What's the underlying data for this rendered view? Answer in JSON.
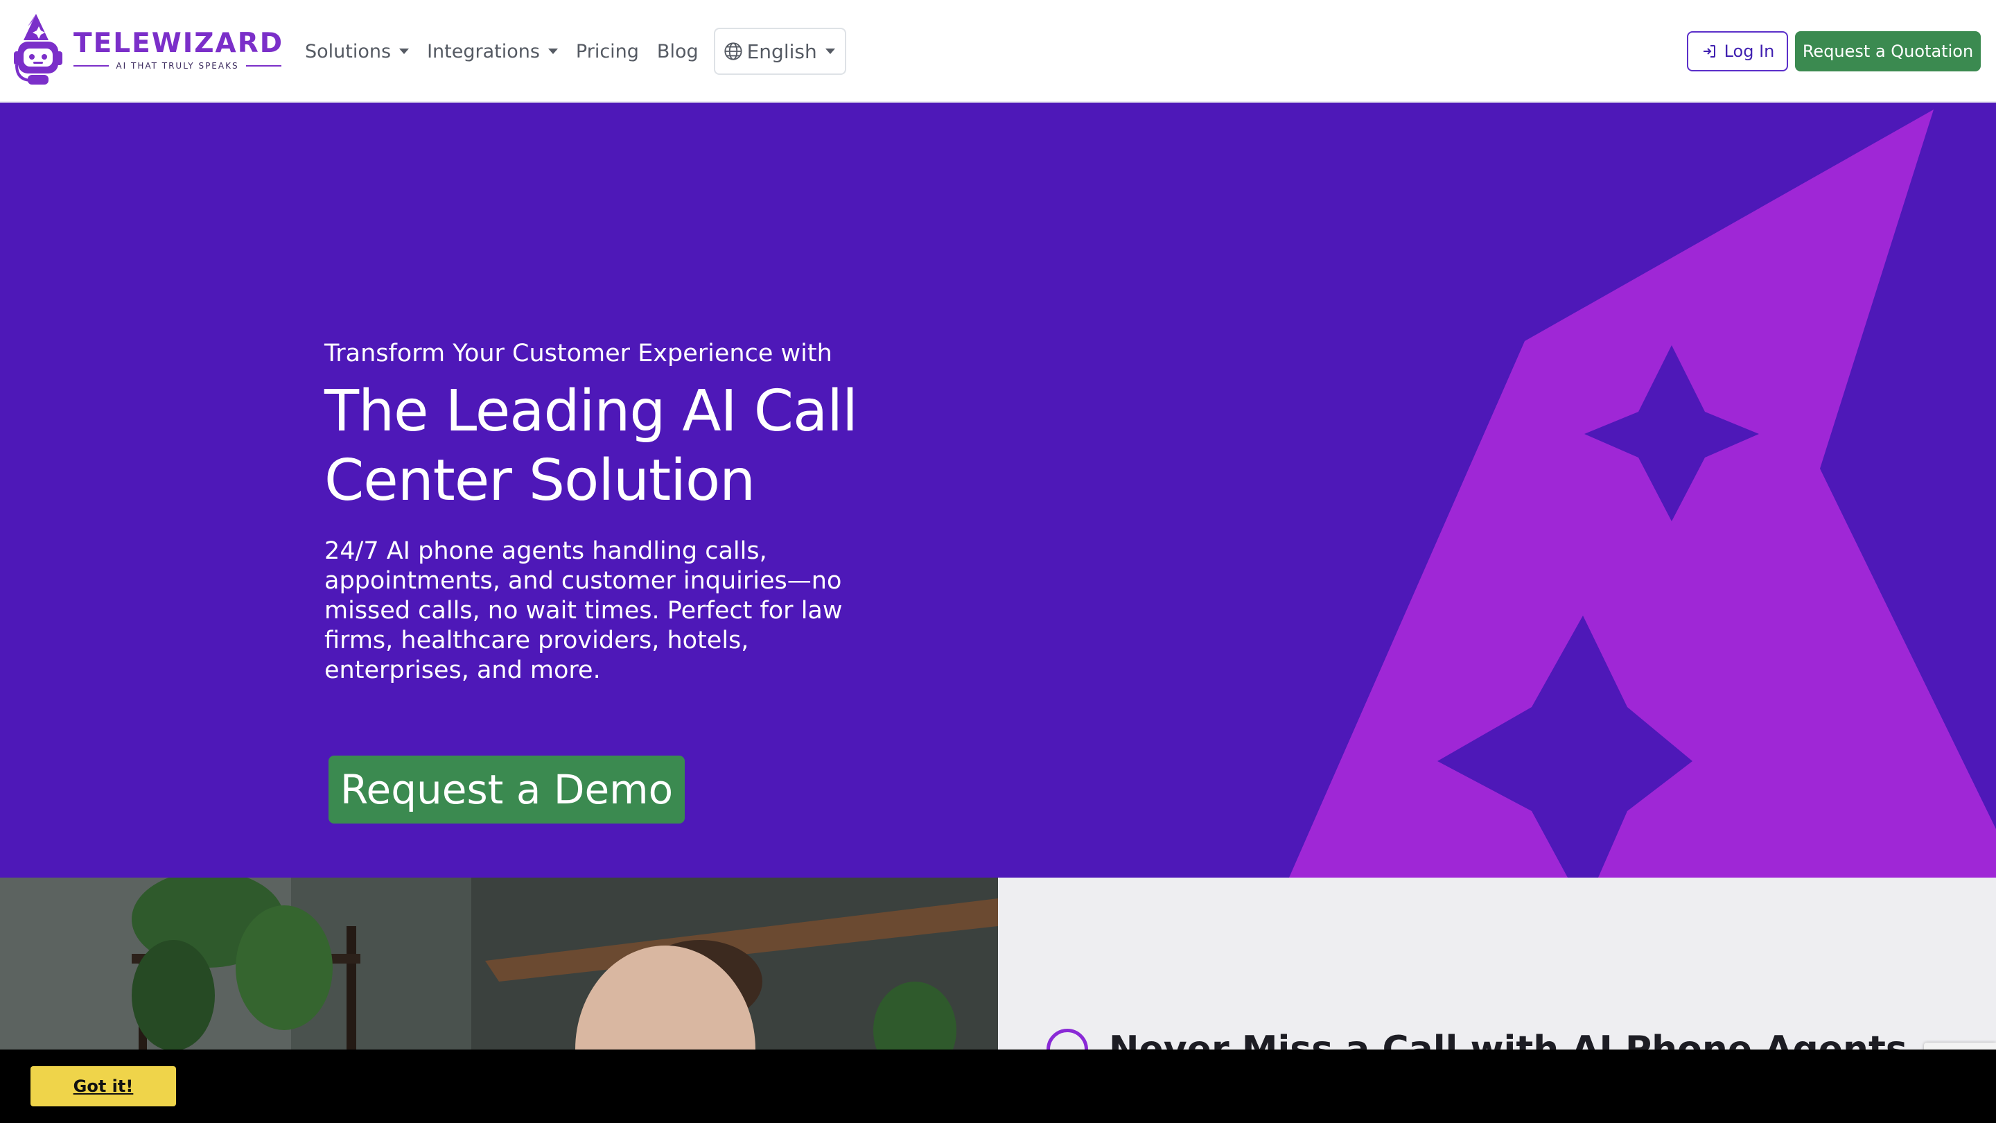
{
  "brand": {
    "name": "TELEWIZARD",
    "tagline": "AI THAT TRULY SPEAKS",
    "primary_color": "#7b2fc9"
  },
  "nav": {
    "items": [
      {
        "label": "Solutions",
        "has_dropdown": true
      },
      {
        "label": "Integrations",
        "has_dropdown": true
      },
      {
        "label": "Pricing",
        "has_dropdown": false
      },
      {
        "label": "Blog",
        "has_dropdown": false
      }
    ],
    "language": {
      "label": "English",
      "icon": "globe-icon"
    }
  },
  "header_actions": {
    "login_label": "Log In",
    "login_icon": "login-icon",
    "quote_label": "Request a Quotation",
    "accent_color": "#3b8a50"
  },
  "hero": {
    "eyebrow": "Transform Your Customer Experience with",
    "title": "The Leading AI Call Center Solution",
    "description": "24/7 AI phone agents handling calls, appointments, and customer inquiries—no missed calls, no wait times. Perfect for law firms, healthcare providers, hotels, enterprises, and more.",
    "cta_label": "Request a Demo",
    "background_color": "#4e18b8",
    "graphic_color": "#9f27d6"
  },
  "feature": {
    "title": "Never Miss a Call with AI Phone Agents",
    "icon": "smile-icon"
  },
  "cookie_bar": {
    "button_label": "Got it!",
    "button_color": "#efd44a"
  }
}
